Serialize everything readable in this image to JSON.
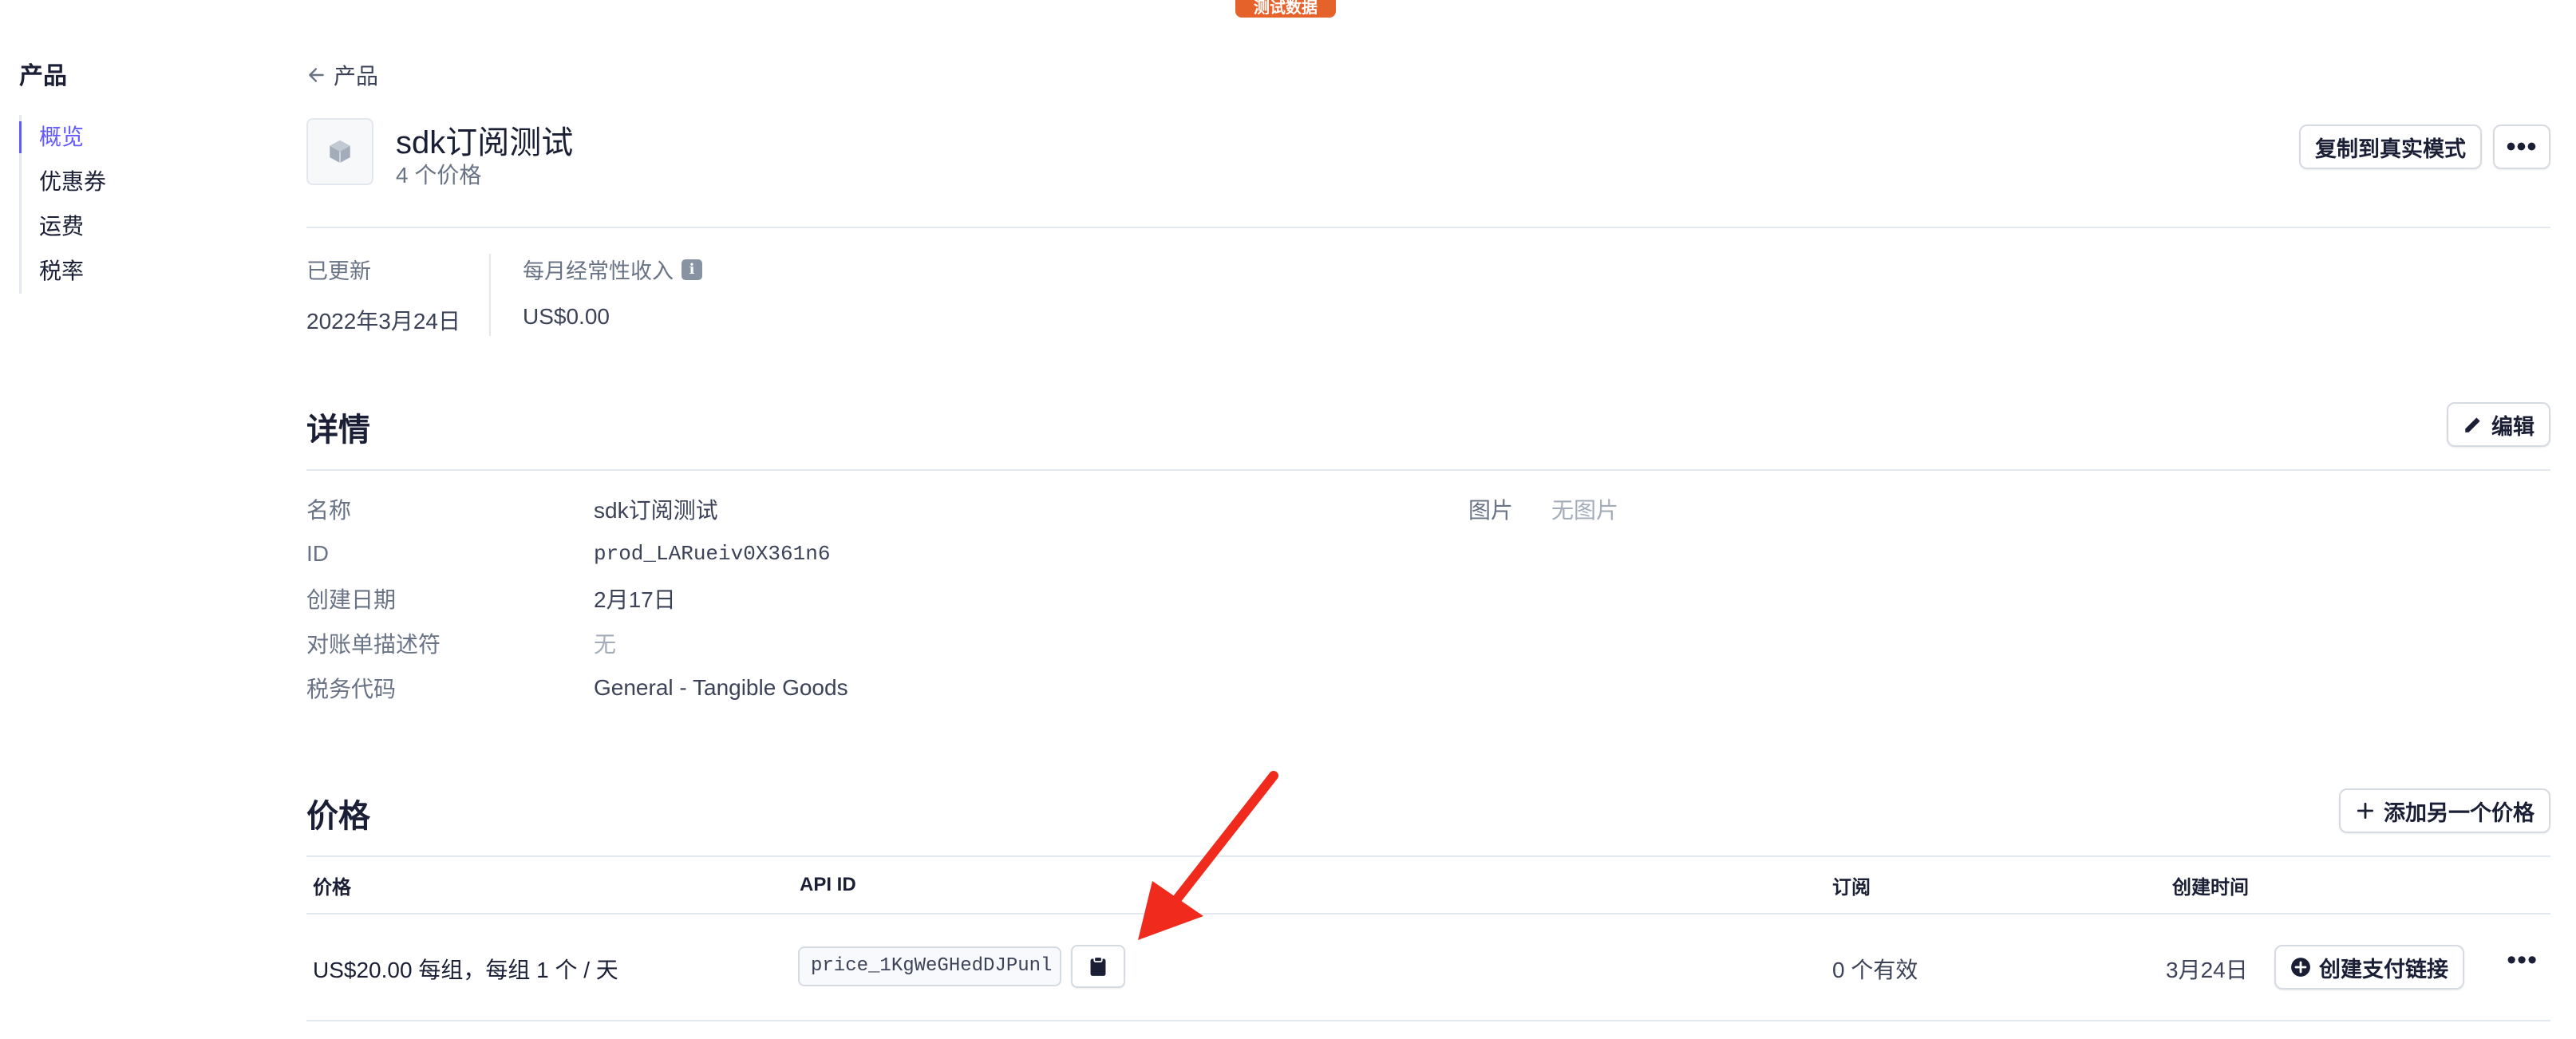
{
  "badge": "测试数据",
  "sidebar": {
    "title": "产品",
    "items": [
      {
        "label": "概览",
        "active": true
      },
      {
        "label": "优惠券",
        "active": false
      },
      {
        "label": "运费",
        "active": false
      },
      {
        "label": "税率",
        "active": false
      }
    ]
  },
  "breadcrumb": "产品",
  "product": {
    "title": "sdk订阅测试",
    "subtitle": "4 个价格",
    "copy_live_label": "复制到真实模式",
    "more_icon": "ellipsis-icon"
  },
  "stats": {
    "updated_label": "已更新",
    "updated_value": "2022年3月24日",
    "mrr_label": "每月经常性收入",
    "mrr_value": "US$0.00",
    "info_icon": "i"
  },
  "details": {
    "title": "详情",
    "edit_label": "编辑",
    "rows": [
      {
        "label": "名称",
        "value": "sdk订阅测试"
      },
      {
        "label": "ID",
        "value": "prod_LARueiv0X361n6"
      },
      {
        "label": "创建日期",
        "value": "2月17日"
      },
      {
        "label": "对账单描述符",
        "value": "无"
      },
      {
        "label": "税务代码",
        "value": "General - Tangible Goods"
      }
    ],
    "image_label": "图片",
    "image_value": "无图片"
  },
  "prices": {
    "title": "价格",
    "add_label": "添加另一个价格",
    "columns": [
      "价格",
      "API ID",
      "订阅",
      "创建时间"
    ],
    "rows": [
      {
        "price": "US$20.00 每组，每组 1 个 / 天",
        "api_id": "price_1KgWeGHedDJPunl",
        "subscriptions": "0 个有效",
        "created": "3月24日",
        "payment_link_label": "创建支付链接"
      }
    ]
  },
  "colors": {
    "accent": "#635bff",
    "badge": "#e5622b",
    "annotation_arrow": "#f02b1d"
  }
}
